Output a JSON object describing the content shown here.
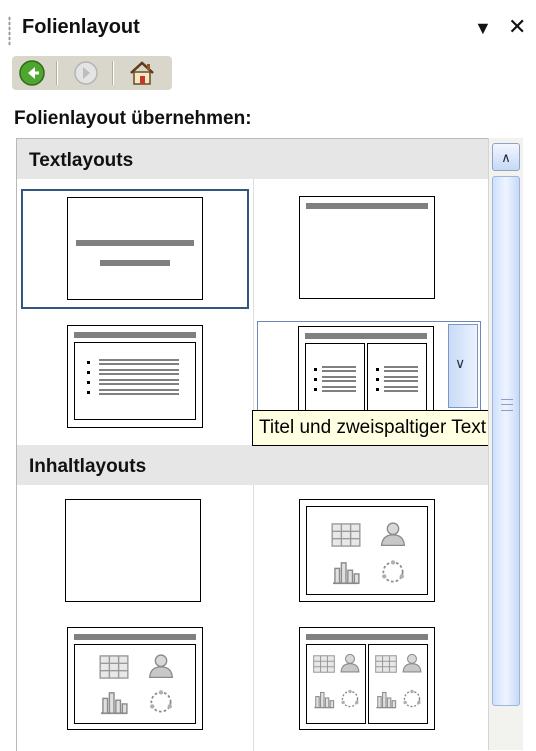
{
  "pane": {
    "title": "Folienlayout",
    "menu_icon": "dropdown-triangle-icon",
    "close_icon": "close-icon"
  },
  "nav": {
    "back_icon": "back-arrow-icon",
    "forward_icon": "forward-arrow-icon",
    "home_icon": "home-icon"
  },
  "apply_label": "Folienlayout übernehmen:",
  "sections": {
    "text": {
      "title": "Textlayouts",
      "items": [
        {
          "layout": "title-slide",
          "selected": true
        },
        {
          "layout": "title-only"
        },
        {
          "layout": "title-and-text"
        },
        {
          "layout": "title-and-two-column-text",
          "hovered": true
        }
      ]
    },
    "content": {
      "title": "Inhaltlayouts",
      "items": [
        {
          "layout": "blank"
        },
        {
          "layout": "content"
        },
        {
          "layout": "title-and-content"
        },
        {
          "layout": "title-and-two-content"
        }
      ]
    }
  },
  "tooltip": "Titel und zweispaltiger Text",
  "colors": {
    "selection_border": "#34557e",
    "hover_border": "#6b87b5",
    "placeholder_bar": "#808080",
    "tooltip_bg": "#ffffe1",
    "nav_bg": "#d9d6cc"
  }
}
